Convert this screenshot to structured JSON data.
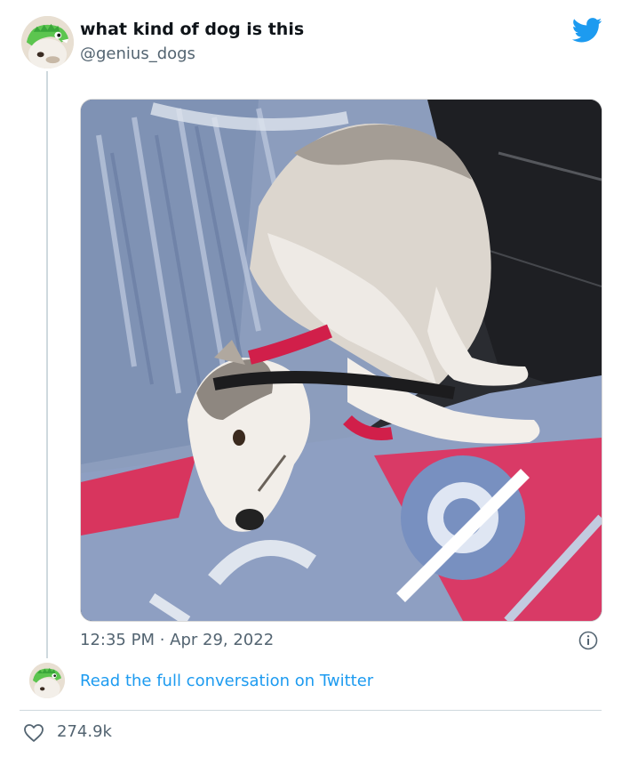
{
  "tweet": {
    "display_name": "what kind of dog is this",
    "handle": "@genius_dogs",
    "timestamp": "12:35 PM · Apr 29, 2022",
    "read_conversation_label": "Read the full conversation on Twitter",
    "like_count": "274.9k",
    "brand_color": "#1d9bf0"
  },
  "icons": {
    "brand": "twitter-bird-icon",
    "info": "info-icon",
    "like": "heart-icon"
  },
  "media": {
    "description_icon": "photo"
  }
}
